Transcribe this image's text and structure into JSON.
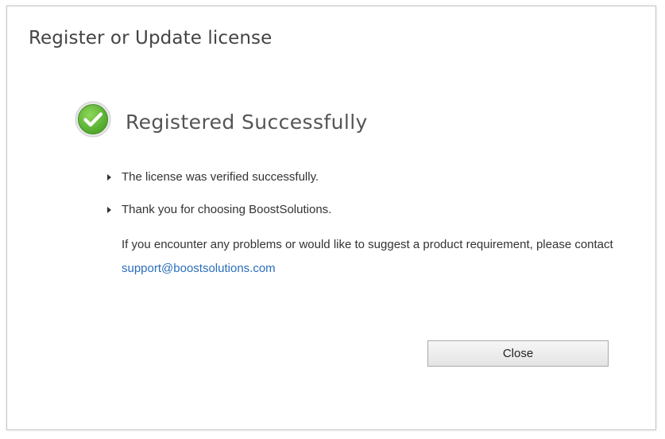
{
  "dialog": {
    "title": "Register or Update license",
    "status_heading": "Registered Successfully",
    "messages": [
      "The license was verified successfully.",
      "Thank you for choosing BoostSolutions."
    ],
    "help_text": "If you encounter any problems or would like to suggest a product requirement, please contact",
    "support_email": "support@boostsolutions.com",
    "close_label": "Close"
  },
  "colors": {
    "success_green": "#6cc43a",
    "link_blue": "#2a6ebb",
    "title_gray": "#444444"
  },
  "icons": {
    "status": "checkmark-circle-icon",
    "bullet": "triangle-right-icon"
  }
}
